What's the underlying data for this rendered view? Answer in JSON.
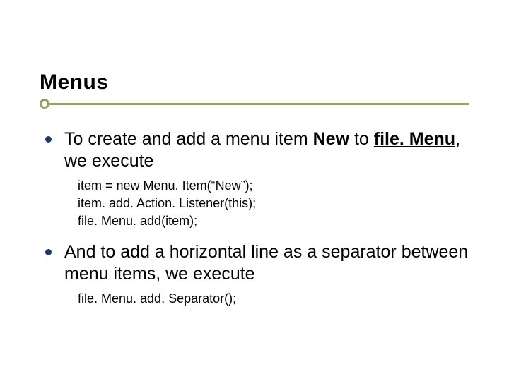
{
  "title": "Menus",
  "items": [
    {
      "text_pre": "To create and add a menu item ",
      "bold1": "New",
      "text_mid": " to ",
      "boldu": "file. Menu",
      "text_post": ", we execute",
      "code": [
        "item = new Menu. Item(“New”);",
        "item. add. Action. Listener(this);",
        "file. Menu. add(item);"
      ]
    },
    {
      "text_plain": "And to add a horizontal line as a separator between menu items, we execute",
      "code": [
        "file. Menu. add. Separator();"
      ]
    }
  ]
}
